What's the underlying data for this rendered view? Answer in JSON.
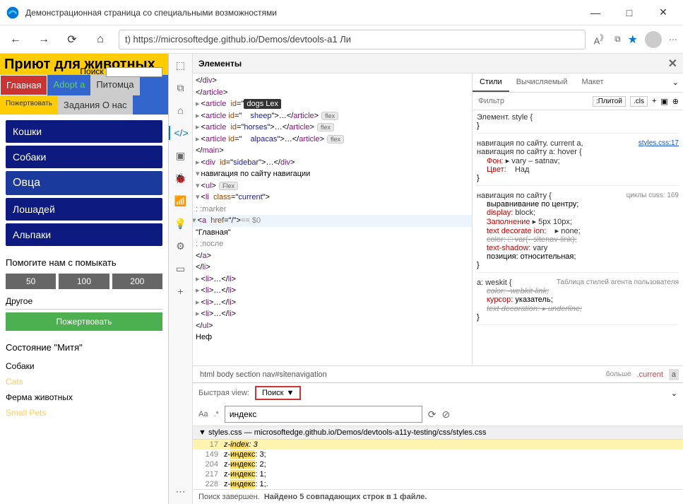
{
  "window": {
    "title": "Демонстрационная страница со специальными возможностями",
    "url": "t) https://microsoftedge.github.io/Demos/devtools-a1 Ли"
  },
  "page": {
    "heading": "Приют для животных",
    "search_label": "Поиск",
    "nav": {
      "main": "Главная",
      "adopt": "Adopt a",
      "pet": "Питомца",
      "donate": "Пожертвовать",
      "tasks": "Задания",
      "about": "О нас"
    },
    "sidebar_items": [
      "Кошки",
      "Собаки",
      "Овца",
      "Лошадей",
      "Альпаки"
    ],
    "donate_heading": "Помогите нам с помыкать",
    "donate_amounts": [
      "50",
      "100",
      "200"
    ],
    "other_label": "Другое",
    "donate_btn": "Пожертвовать",
    "status_heading": "Состояние \"Митя\"",
    "status_items": [
      "Собаки",
      "Cats",
      "Ферма животных",
      "Small Pets"
    ]
  },
  "devtools": {
    "panel_title": "Элементы",
    "elements": {
      "article_dogs_id": "dogs Lex",
      "article_sheep": "sheep",
      "article_horses": "horses",
      "article_alpacas": "alpacas",
      "flex_badge": "Flex",
      "flex_lc": "flex",
      "sidebar_id": "sidebar",
      "nav_text": "навигация по сайту навигации",
      "li_class": "current",
      "a_href": "/",
      "eq0": "== $0",
      "home_text": "Главная",
      "marker": ": :marker",
      "after": ": :после",
      "nef": "Неф"
    },
    "crumbs": {
      "path": "html body section nav#sitenavigation",
      "more": "больше",
      "cur": ".current",
      "a": "a"
    },
    "styles": {
      "tabs": [
        "Стили",
        "Вычисляемый",
        "Макет"
      ],
      "filter_placeholder": "Фильтр",
      "hover_chip": ":Плитой",
      "cls_chip": ".cls",
      "element_style": "Элемент. style {",
      "rule1_sel": "навигация по сайту. current a,\nнавигация по сайту a: hover {",
      "rule1_link": "styles.css:17",
      "rule1_props": [
        {
          "n": "Фон:",
          "v": "▸ vary – satnav;"
        },
        {
          "n": "Цвет:",
          "v": "Над"
        }
      ],
      "rule2_sel": "навигация по сайту {",
      "rule2_meta": "циклы cuss: 169",
      "rule2_props": [
        {
          "n": "выравнивание по центру;",
          "v": ""
        },
        {
          "n": "display:",
          "v": "block;"
        },
        {
          "n": "Заполнение",
          "v": "▸ 5px 10px;"
        },
        {
          "n": "text decorate ion:",
          "v": "▸ none;"
        },
        {
          "n_strike": "color:",
          "v_strike": "□ var(--sitenav-link);"
        },
        {
          "n": "text-shadow:",
          "v": "vary"
        },
        {
          "n": "позиция: относительная;",
          "v": ""
        }
      ],
      "rule3_sel": "a: weskit {",
      "rule3_meta": "Таблица стилей агента пользователя",
      "rule3_props": [
        {
          "strike": "color: -webkit-link;"
        },
        {
          "n": "курсор:",
          "v": "указатель;"
        },
        {
          "strike": "text decoration: ▸ underline;"
        }
      ]
    },
    "drawer": {
      "qv_label": "Быстрая view:",
      "qv_value": "Поиск",
      "search_opts": [
        "Aa",
        ".*"
      ],
      "search_value": "индекс",
      "file_header": "▼ styles.css — microsoftedge.github.io/Demos/devtools-a11y-testing/css/styles.css",
      "results": [
        {
          "line": "17",
          "text_pre": "z-",
          "match": "index",
          "text_post": ": 3",
          "sel": true,
          "italic": true
        },
        {
          "line": "149",
          "text_pre": "z-",
          "match": "индекс",
          "text_post": ": 3;"
        },
        {
          "line": "204",
          "text_pre": "z-",
          "match": "индекс",
          "text_post": ": 2;"
        },
        {
          "line": "217",
          "text_pre": "z-",
          "match": "индекс",
          "text_post": ": 1;"
        },
        {
          "line": "228",
          "text_pre": "z-",
          "match": "индекс",
          "text_post": ": 1;."
        }
      ],
      "status_label": "Поиск завершен.",
      "status_found": "Найдено 5 совпадающих строк в 1 файле."
    }
  }
}
